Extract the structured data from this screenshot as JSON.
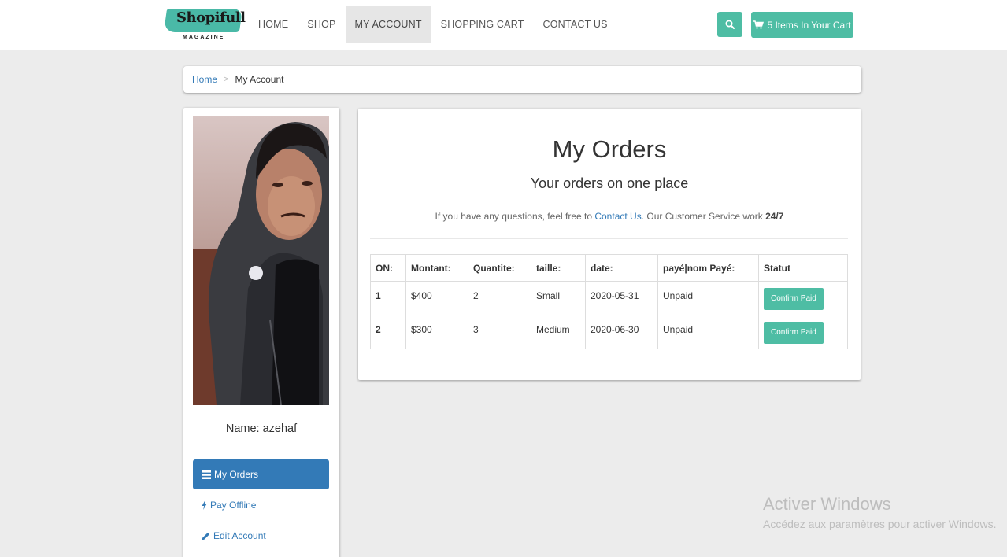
{
  "navbar": {
    "logo": {
      "brand": "Shopifull",
      "sub": "MAGAZINE"
    },
    "items": [
      {
        "label": "HOME",
        "active": false
      },
      {
        "label": "SHOP",
        "active": false
      },
      {
        "label": "MY ACCOUNT",
        "active": true
      },
      {
        "label": "SHOPPING CART",
        "active": false
      },
      {
        "label": "CONTACT US",
        "active": false
      }
    ],
    "search_icon": "search-icon",
    "cart": {
      "icon": "cart-icon",
      "label": "5 Items In Your Cart"
    }
  },
  "breadcrumb": {
    "home": "Home",
    "separator": ">",
    "current": "My Account"
  },
  "sidebar": {
    "photo": "profile-photo",
    "name_line": "Name: azehaf",
    "menu": [
      {
        "icon": "list-icon",
        "label": "My Orders",
        "active": true
      },
      {
        "icon": "bolt-icon",
        "label": "Pay Offline",
        "active": false
      },
      {
        "icon": "pencil-icon",
        "label": "Edit Account",
        "active": false
      }
    ]
  },
  "main": {
    "title": "My Orders",
    "subtitle": "Your orders on one place",
    "note": {
      "before": "If you have any questions, feel free to ",
      "link": "Contact Us",
      "middle": ". Our Customer Service work ",
      "bold": "24/7"
    },
    "table": {
      "headers": [
        "ON:",
        "Montant:",
        "Quantite:",
        "taille:",
        "date:",
        "payé|nom Payé:",
        "Statut"
      ],
      "rows": [
        {
          "on": "1",
          "montant": "$400",
          "quantite": "2",
          "taille": "Small",
          "date": "2020-05-31",
          "paye": "Unpaid",
          "action": "Confirm Paid"
        },
        {
          "on": "2",
          "montant": "$300",
          "quantite": "3",
          "taille": "Medium",
          "date": "2020-06-30",
          "paye": "Unpaid",
          "action": "Confirm Paid"
        }
      ]
    }
  },
  "watermark": {
    "title": "Activer Windows",
    "sub": "Accédez aux paramètres pour activer Windows."
  },
  "colors": {
    "accent": "#4ebda4",
    "primary": "#337ab7",
    "background": "#ececec"
  }
}
